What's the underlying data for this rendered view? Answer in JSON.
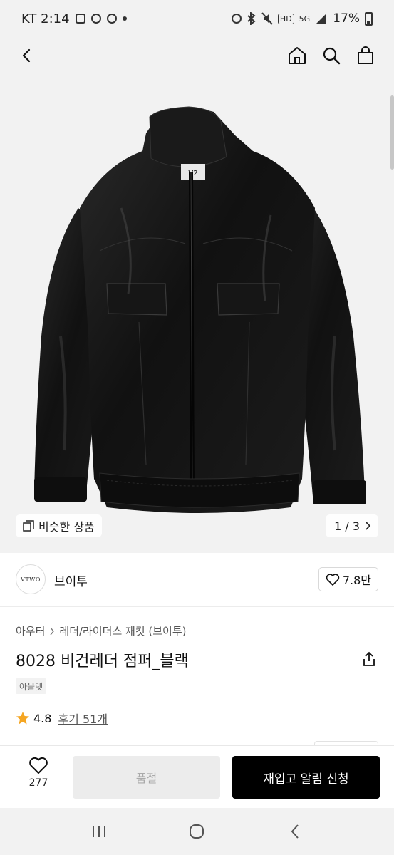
{
  "status_bar": {
    "carrier_time": "KT 2:14",
    "network": "5G",
    "battery": "17%"
  },
  "nav": {
    "back_icon": "chevron-left-icon",
    "home_icon": "home-icon",
    "search_icon": "search-icon",
    "bag_icon": "shopping-bag-icon"
  },
  "gallery": {
    "similar_label": "비슷한 상품",
    "pager": "1 / 3",
    "jacket_tag": "V2"
  },
  "brand": {
    "logo_text": "VTWO",
    "name": "브이투",
    "like_count": "7.8만"
  },
  "product": {
    "breadcrumb": [
      "아우터",
      "레더/라이더스 재킷 (브이투)"
    ],
    "title": "8028 비건레더 점퍼_블랙",
    "tag": "아울렛",
    "rating": "4.8",
    "review_label": "후기 51개"
  },
  "action_bar": {
    "wish_count": "277",
    "soldout_label": "품절",
    "notify_label": "재입고 알림 신청"
  },
  "colors": {
    "accent_star": "#f5a623",
    "primary_button": "#000000",
    "disabled_button": "#ececec"
  }
}
